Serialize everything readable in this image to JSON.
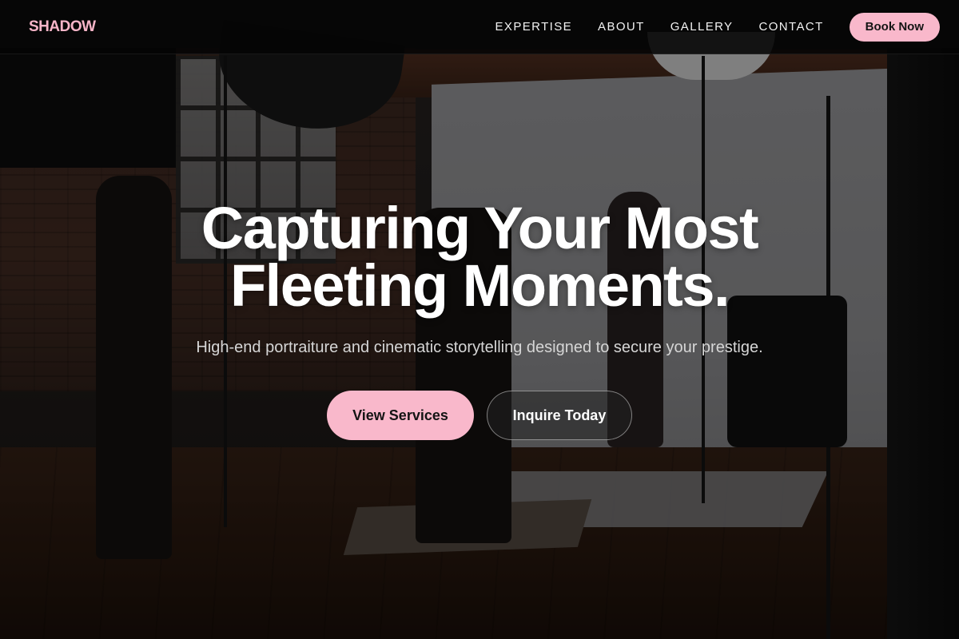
{
  "brand": {
    "logo_text": "SHADOW"
  },
  "nav": {
    "links": [
      "EXPERTISE",
      "ABOUT",
      "GALLERY",
      "CONTACT"
    ],
    "cta_label": "Book Now"
  },
  "hero": {
    "title_line1": "Capturing Your Most",
    "title_line2": "Fleeting Moments.",
    "subtitle": "High-end portraiture and cinematic storytelling designed to secure your prestige.",
    "primary_cta": "View Services",
    "secondary_cta": "Inquire Today"
  },
  "colors": {
    "accent_pink": "#f9b8cb",
    "logo_pink": "#f7b5c8",
    "header_bg": "#050505"
  }
}
